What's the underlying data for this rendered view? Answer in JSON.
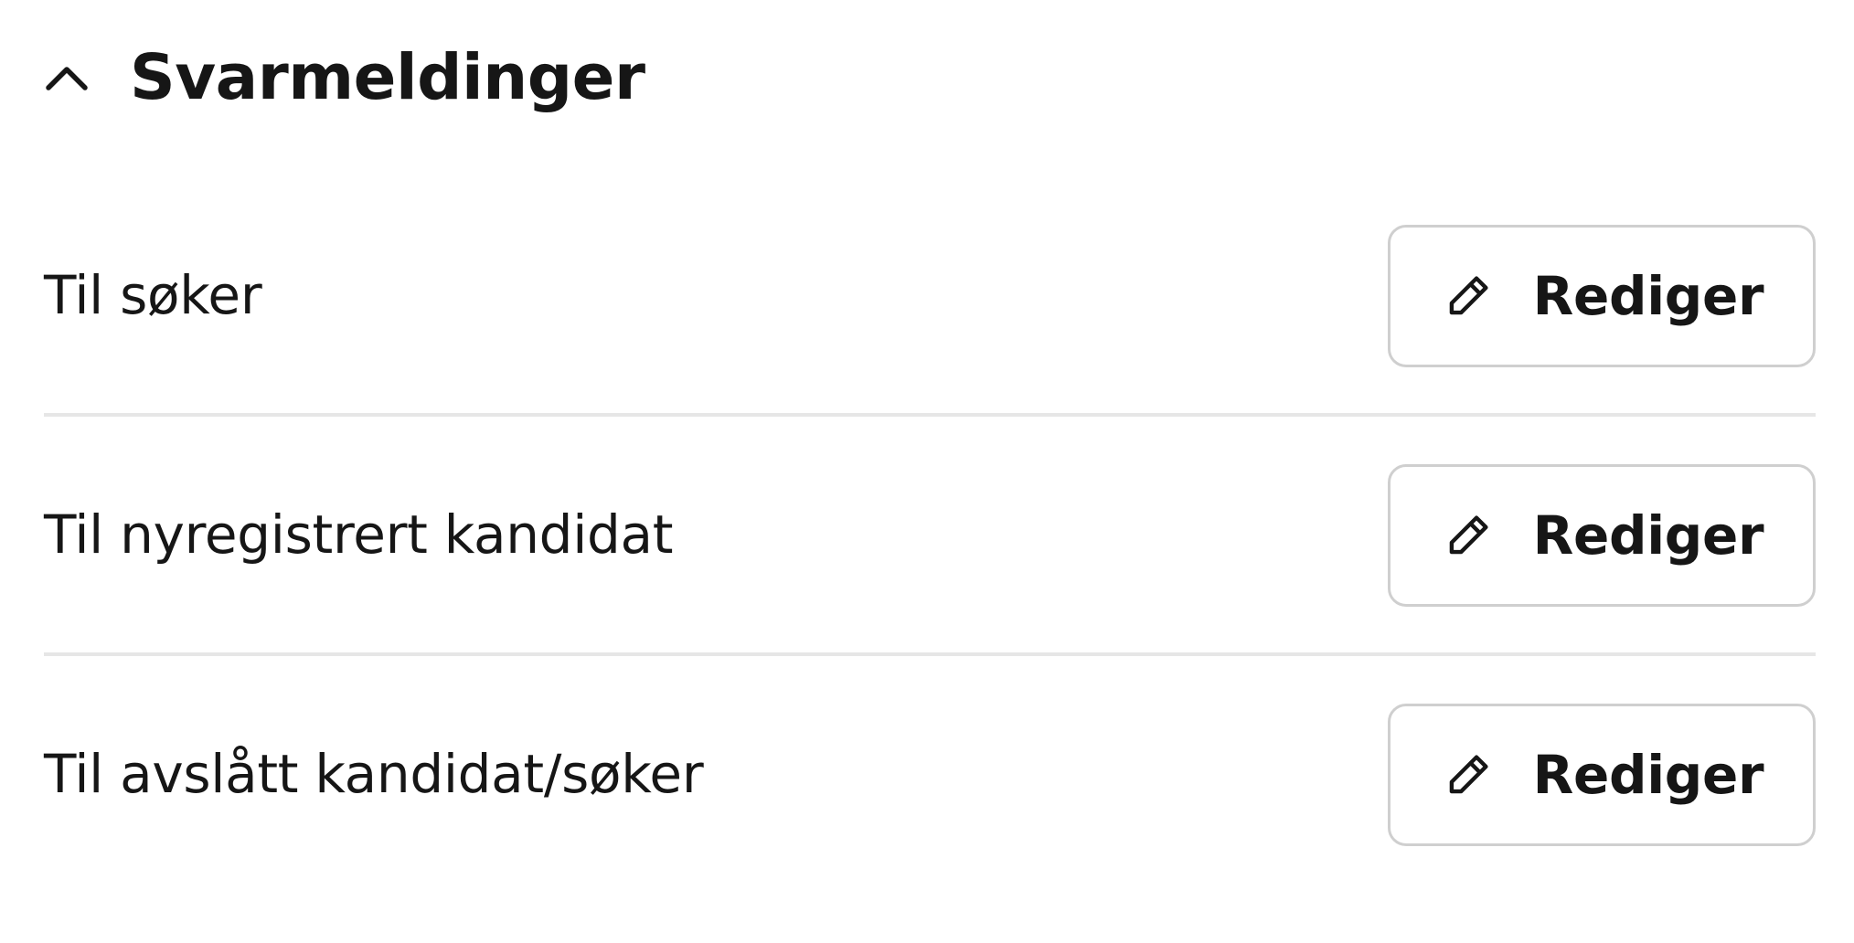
{
  "section": {
    "title": "Svarmeldinger",
    "expanded": true,
    "toggle_icon": "chevron-up-icon"
  },
  "rows": [
    {
      "label": "Til søker",
      "button_label": "Rediger",
      "button_icon": "pencil-icon"
    },
    {
      "label": "Til nyregistrert kandidat",
      "button_label": "Rediger",
      "button_icon": "pencil-icon"
    },
    {
      "label": "Til avslått kandidat/søker",
      "button_label": "Rediger",
      "button_icon": "pencil-icon"
    }
  ],
  "colors": {
    "text": "#161616",
    "button_border": "#cfcfcf",
    "divider": "#e6e6e6",
    "background": "#ffffff"
  }
}
